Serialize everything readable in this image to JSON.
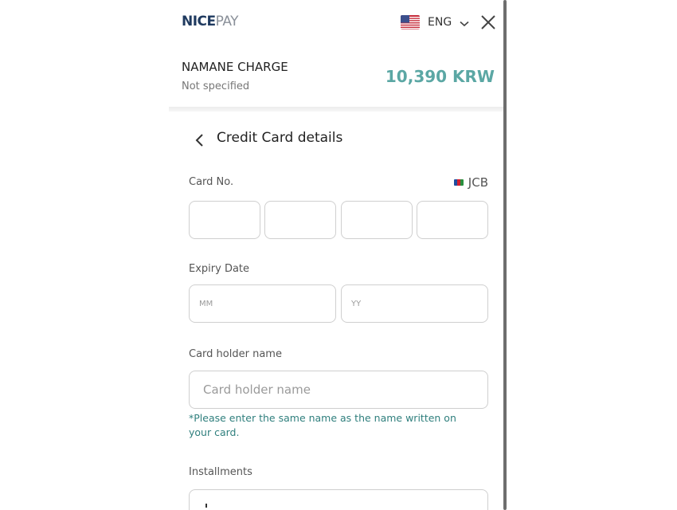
{
  "header": {
    "logo_bold": "NICE",
    "logo_light": "PAY",
    "language": "ENG"
  },
  "order": {
    "merchant": "NAMANE CHARGE",
    "subtitle": "Not specified",
    "amount": "10,390 KRW"
  },
  "form": {
    "title": "Credit Card details",
    "card_number": {
      "label": "Card No.",
      "brand": "JCB",
      "segments": [
        "",
        "",
        "",
        ""
      ]
    },
    "expiry": {
      "label": "Expiry Date",
      "month_placeholder": "MM",
      "year_placeholder": "YY"
    },
    "holder": {
      "label": "Card holder name",
      "placeholder": "Card holder name",
      "hint": "*Please enter the same name as the name written on your card."
    },
    "installments": {
      "label": "Installments"
    }
  },
  "icons": {
    "flag": "us-flag-icon",
    "chevron": "chevron-down-icon",
    "close": "close-icon",
    "back": "chevron-left-icon",
    "brand": "jcb-card-icon"
  },
  "colors": {
    "amount": "#5ba7a4",
    "hint": "#2f7f7d",
    "logo": "#1f3a5f",
    "border": "#cfcfcf"
  }
}
